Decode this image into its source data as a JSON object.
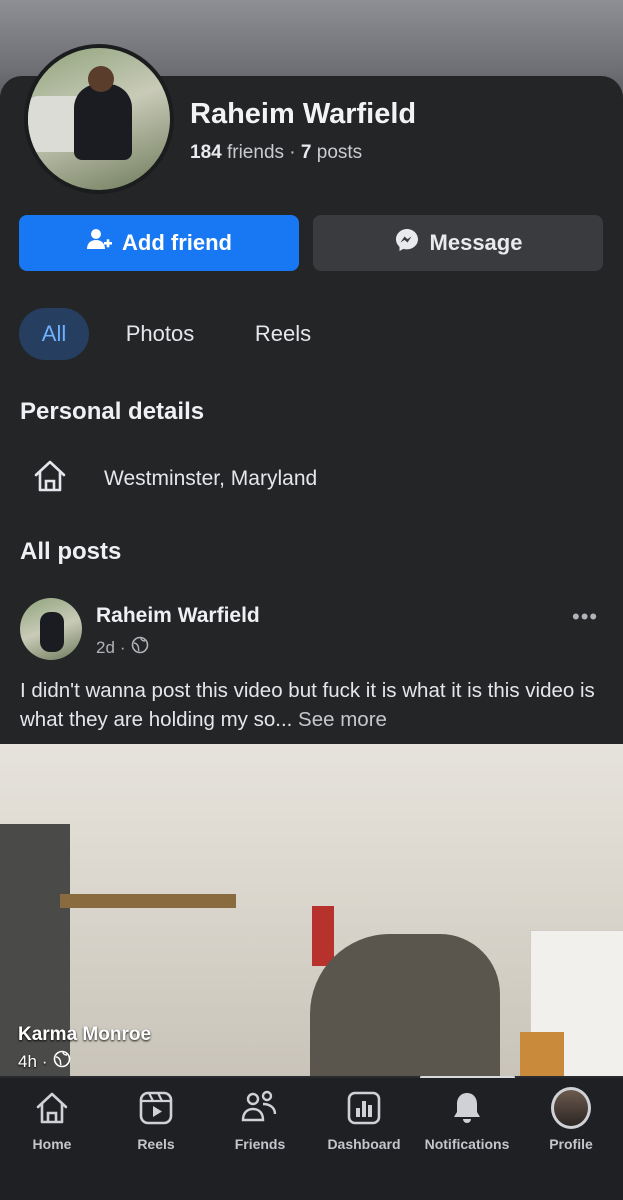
{
  "profile": {
    "name": "Raheim Warfield",
    "friends_count": "184",
    "friends_label": "friends",
    "separator": "·",
    "posts_count": "7",
    "posts_label": "posts"
  },
  "actions": {
    "add_friend": "Add friend",
    "message": "Message"
  },
  "tabs": [
    {
      "label": "All",
      "active": true
    },
    {
      "label": "Photos",
      "active": false
    },
    {
      "label": "Reels",
      "active": false
    }
  ],
  "personal_details": {
    "title": "Personal details",
    "location": "Westminster, Maryland",
    "location_icon": "home-icon"
  },
  "posts_section": {
    "title": "All posts"
  },
  "post": {
    "author": "Raheim Warfield",
    "time": "2d",
    "separator": "·",
    "privacy_icon": "globe-icon",
    "menu_icon": "more-dots-icon",
    "text": "I didn't wanna post this video but fuck it is what it is this video is what they are holding my so...",
    "see_more": "See more"
  },
  "overlay": {
    "name": "Karma Monroe",
    "time": "4h",
    "separator": "·"
  },
  "bottom_nav": [
    {
      "label": "Home",
      "icon": "home-icon"
    },
    {
      "label": "Reels",
      "icon": "reels-icon"
    },
    {
      "label": "Friends",
      "icon": "friends-icon"
    },
    {
      "label": "Dashboard",
      "icon": "dashboard-icon"
    },
    {
      "label": "Notifications",
      "icon": "bell-icon"
    },
    {
      "label": "Profile",
      "icon": "profile-avatar-icon"
    }
  ],
  "colors": {
    "accent": "#1877f2",
    "background": "#242527",
    "active_tab_bg": "#263e5f",
    "active_tab_text": "#6fb0ff"
  }
}
